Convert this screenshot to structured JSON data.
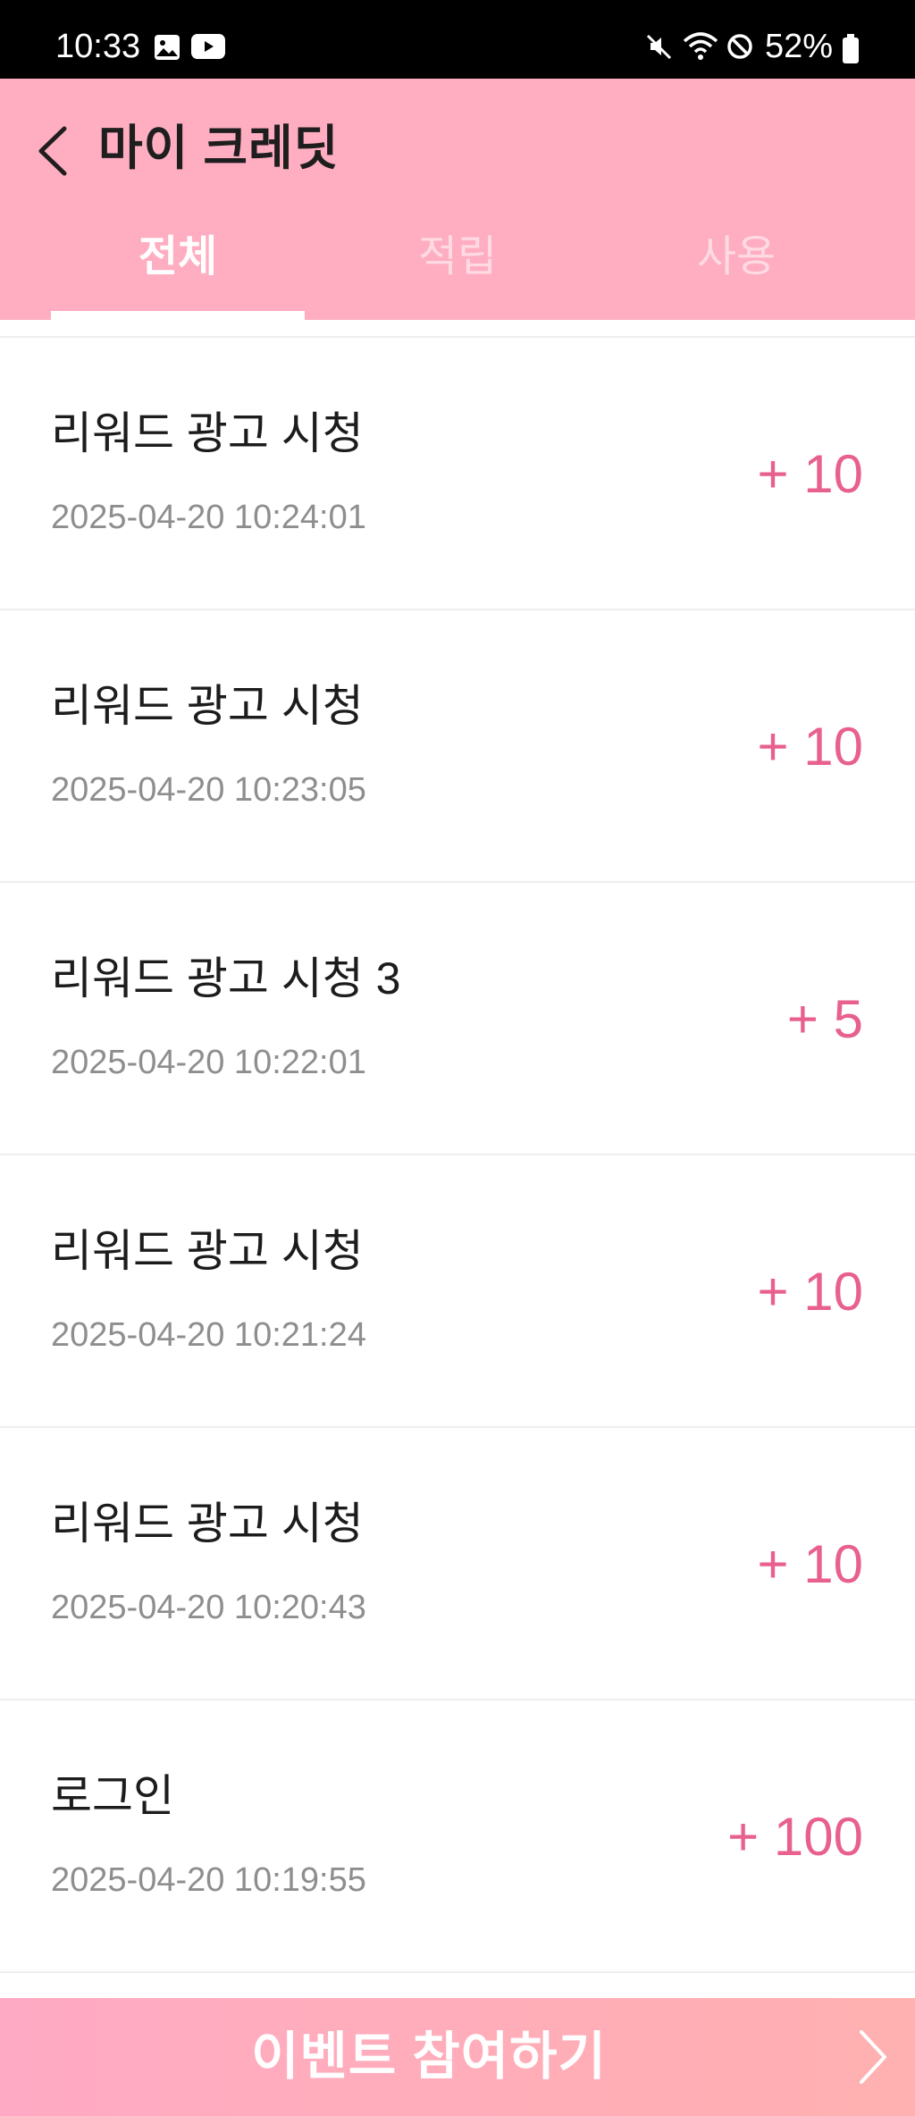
{
  "status_bar": {
    "time": "10:33",
    "battery": "52%",
    "icons": [
      "gallery-icon",
      "youtube-icon",
      "mute-icon",
      "wifi-icon",
      "block-icon",
      "battery-icon"
    ]
  },
  "header": {
    "title": "마이 크레딧",
    "back_icon": "chevron-left-icon",
    "background_color": "#ffadc1"
  },
  "tabs": [
    {
      "label": "전체",
      "active": true
    },
    {
      "label": "적립",
      "active": false
    },
    {
      "label": "사용",
      "active": false
    }
  ],
  "history": [
    {
      "title": "리워드 광고 시청",
      "date": "2025-04-20 10:24:01",
      "amount": "+ 10"
    },
    {
      "title": "리워드 광고 시청",
      "date": "2025-04-20 10:23:05",
      "amount": "+ 10"
    },
    {
      "title": "리워드 광고 시청 3",
      "date": "2025-04-20 10:22:01",
      "amount": "+ 5"
    },
    {
      "title": "리워드 광고 시청",
      "date": "2025-04-20 10:21:24",
      "amount": "+ 10"
    },
    {
      "title": "리워드 광고 시청",
      "date": "2025-04-20 10:20:43",
      "amount": "+ 10"
    },
    {
      "title": "로그인",
      "date": "2025-04-20 10:19:55",
      "amount": "+ 100"
    }
  ],
  "event_banner": {
    "label": "이벤트 참여하기",
    "icon": "chevron-right-icon"
  },
  "colors": {
    "accent": "#e8608e",
    "header": "#ffadc1"
  }
}
